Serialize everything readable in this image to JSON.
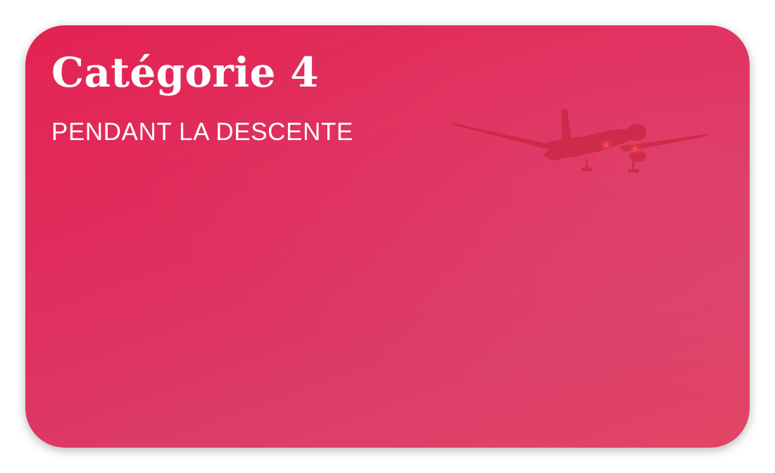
{
  "card": {
    "title": "Catégorie 4",
    "subtitle": "PENDANT LA DESCENTE",
    "image_icon": "airplane-landing-icon",
    "background_colors": [
      "#e32352",
      "#db3f6a"
    ]
  }
}
